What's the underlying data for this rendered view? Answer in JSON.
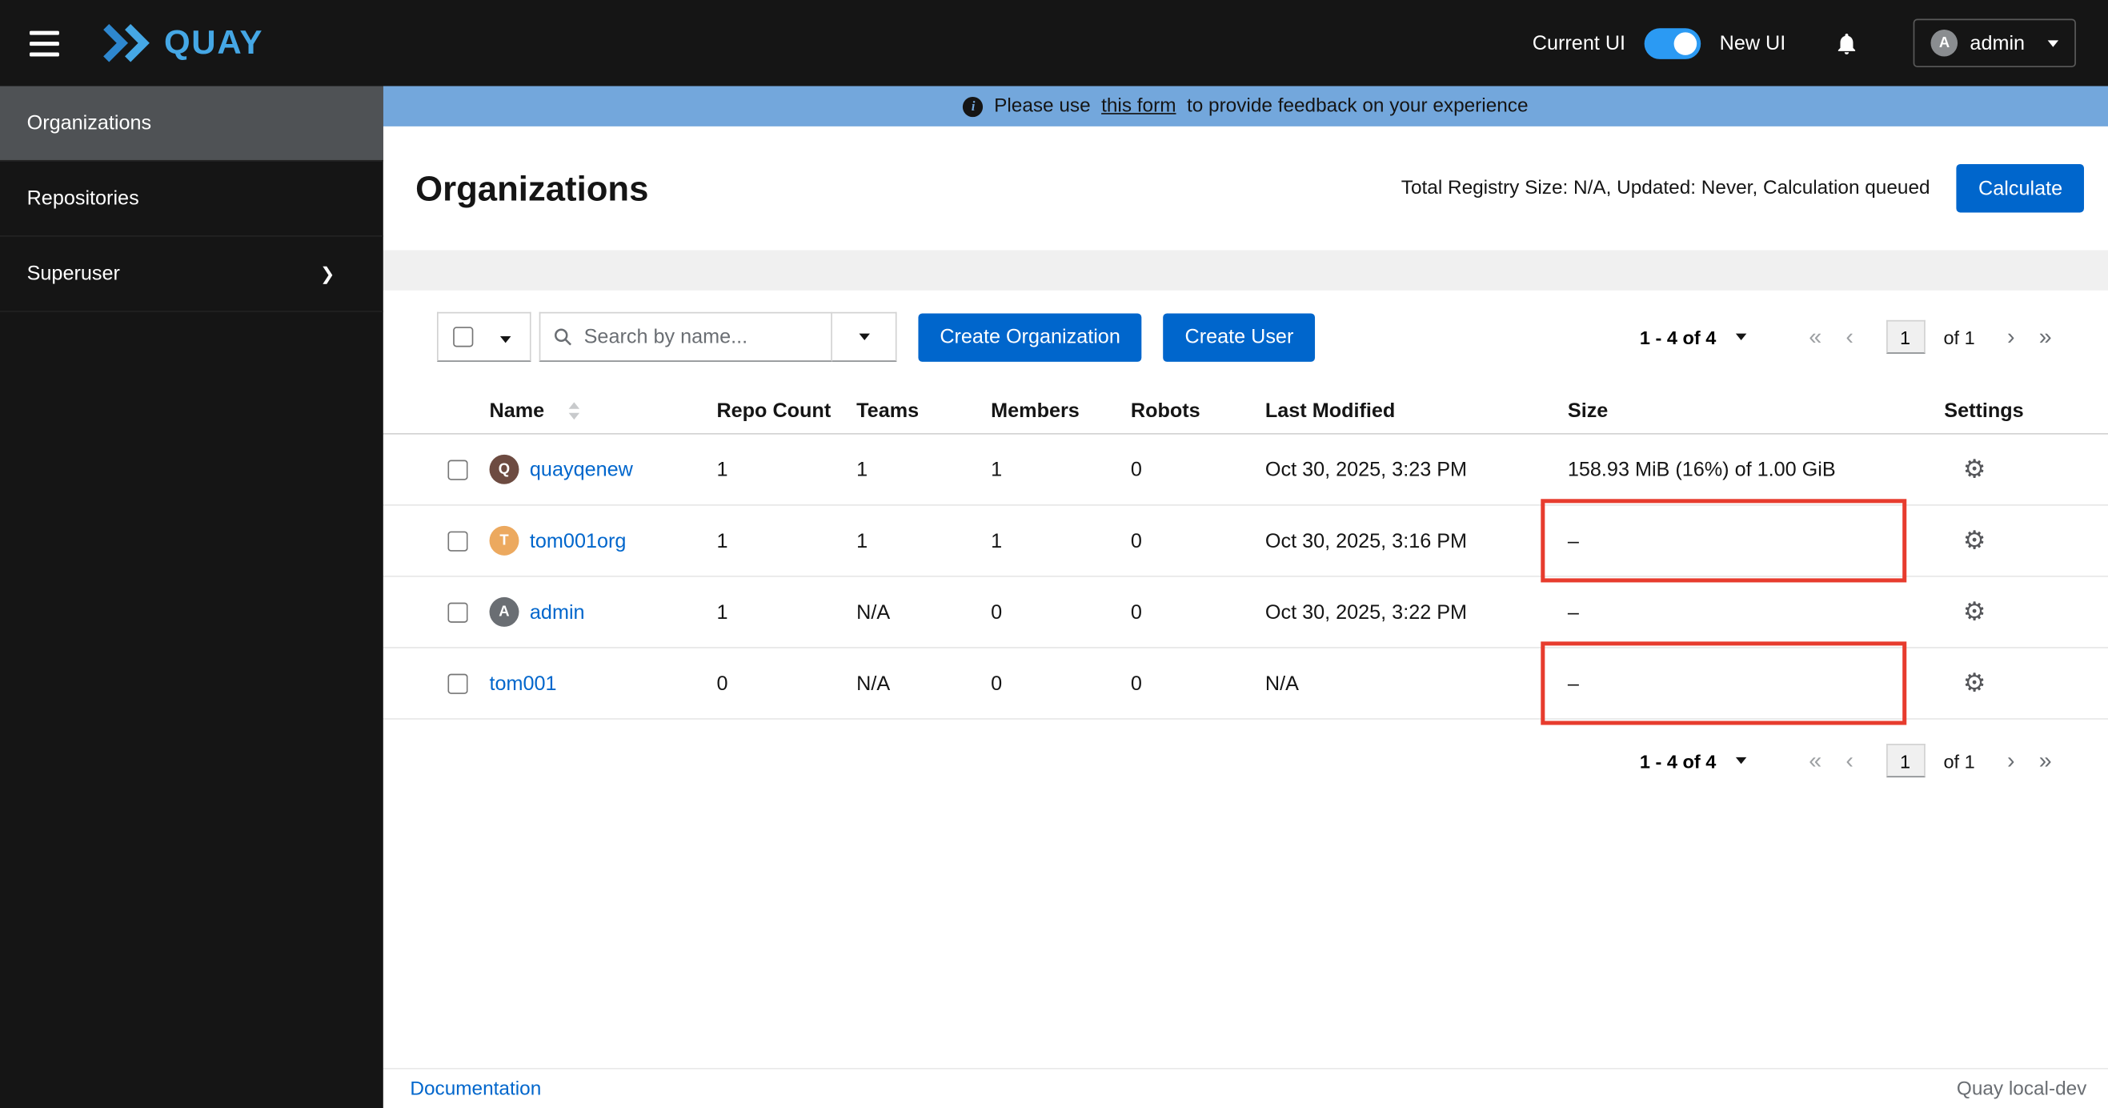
{
  "colors": {
    "primary": "#0066cc",
    "link": "#0066cc",
    "banner_bg": "#73a7dc",
    "toggle_on": "#2b9af3",
    "brand_blue": "#45a7e5",
    "annotation_red": "#e73c2e",
    "masthead_bg": "#151515",
    "sidebar_active_bg": "#4f5255"
  },
  "masthead": {
    "brand": "QUAY",
    "current_ui_label": "Current UI",
    "new_ui_label": "New UI",
    "user": {
      "name": "admin",
      "initial": "A"
    }
  },
  "sidebar": {
    "items": [
      {
        "label": "Organizations"
      },
      {
        "label": "Repositories"
      },
      {
        "label": "Superuser"
      }
    ]
  },
  "banner": {
    "prefix": "Please use",
    "link_text": "this form",
    "suffix": "to provide feedback on your experience"
  },
  "page": {
    "title": "Organizations",
    "registry_summary": "Total Registry Size: N/A, Updated: Never, Calculation queued",
    "calculate_label": "Calculate"
  },
  "toolbar": {
    "search_placeholder": "Search by name...",
    "create_org_label": "Create Organization",
    "create_user_label": "Create User"
  },
  "pagination": {
    "range": "1 - 4 of 4",
    "current_page": "1",
    "of_label": "of 1",
    "first": "«",
    "prev": "‹",
    "next": "›",
    "last": "»"
  },
  "table": {
    "headers": [
      "Name",
      "Repo Count",
      "Teams",
      "Members",
      "Robots",
      "Last Modified",
      "Size",
      "Settings"
    ],
    "rows": [
      {
        "name": "quayqenew",
        "initial": "Q",
        "avatar_color": "#6d4b41",
        "repo_count": "1",
        "teams": "1",
        "members": "1",
        "robots": "0",
        "last_modified": "Oct 30, 2025, 3:23 PM",
        "size": "158.93 MiB (16%) of 1.00 GiB"
      },
      {
        "name": "tom001org",
        "initial": "T",
        "avatar_color": "#eca95f",
        "repo_count": "1",
        "teams": "1",
        "members": "1",
        "robots": "0",
        "last_modified": "Oct 30, 2025, 3:16 PM",
        "size": "–"
      },
      {
        "name": "admin",
        "initial": "A",
        "avatar_color": "#6a6e73",
        "repo_count": "1",
        "teams": "N/A",
        "members": "0",
        "robots": "0",
        "last_modified": "Oct 30, 2025, 3:22 PM",
        "size": "–"
      },
      {
        "name": "tom001",
        "initial": "",
        "avatar_color": "",
        "repo_count": "0",
        "teams": "N/A",
        "members": "0",
        "robots": "0",
        "last_modified": "N/A",
        "size": "–"
      }
    ]
  },
  "footer": {
    "docs_link": "Documentation",
    "version_label": "Quay local-dev"
  }
}
